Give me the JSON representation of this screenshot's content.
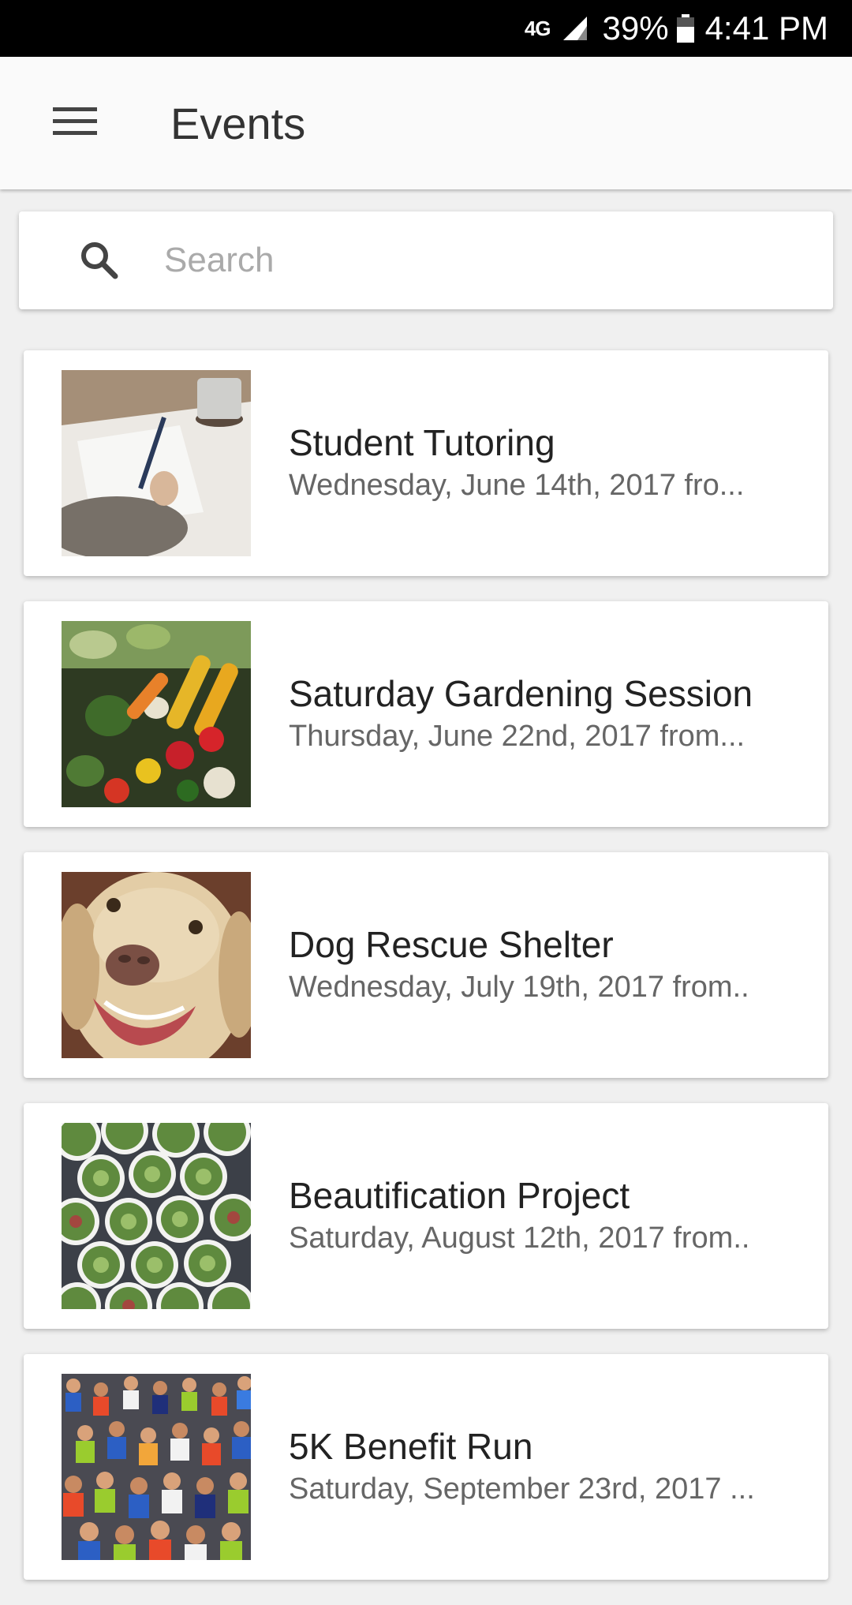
{
  "status_bar": {
    "network": "4G",
    "battery": "39%",
    "time": "4:41 PM"
  },
  "app_bar": {
    "title": "Events",
    "menu_icon": "hamburger-menu-icon"
  },
  "search": {
    "placeholder": "Search",
    "value": "",
    "icon": "search-icon"
  },
  "events": [
    {
      "title": "Student Tutoring",
      "date": "Wednesday, June 14th, 2017 fro..."
    },
    {
      "title": "Saturday Gardening Session",
      "date": "Thursday, June 22nd, 2017 from..."
    },
    {
      "title": "Dog Rescue Shelter",
      "date": "Wednesday, July 19th, 2017 from.."
    },
    {
      "title": "Beautification Project",
      "date": "Saturday, August 12th, 2017 from.."
    },
    {
      "title": "5K Benefit Run",
      "date": "Saturday, September 23rd, 2017 ..."
    }
  ],
  "colors": {
    "status_bar": "#000000",
    "app_bar": "#fafafa",
    "background": "#f0f0f0",
    "card": "#ffffff",
    "title_text": "#222222",
    "subtitle_text": "#666666"
  }
}
